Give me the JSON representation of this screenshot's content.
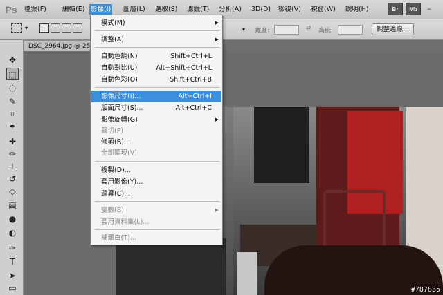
{
  "app": {
    "logo": "Ps"
  },
  "menubar": {
    "items": [
      "檔案(F)",
      "編輯(E)",
      "影像(I)",
      "圖層(L)",
      "選取(S)",
      "濾鏡(T)",
      "分析(A)",
      "3D(D)",
      "檢視(V)",
      "視窗(W)",
      "說明(H)"
    ],
    "active_index": 2,
    "right_icons": [
      "Br",
      "Mb"
    ],
    "window_buttons": [
      "–",
      "□",
      "×"
    ]
  },
  "options": {
    "width_label": "寬度:",
    "height_label": "高度:",
    "refine_edge_button": "調整邊緣..."
  },
  "document": {
    "tab_title": "DSC_2964.jpg @ 25"
  },
  "image_menu": {
    "items": [
      {
        "label": "模式(M)",
        "shortcut": "",
        "submenu": true,
        "disabled": false
      },
      {
        "label": "調整(A)",
        "shortcut": "",
        "submenu": true,
        "disabled": false
      },
      {
        "label": "自動色調(N)",
        "shortcut": "Shift+Ctrl+L",
        "submenu": false,
        "disabled": false
      },
      {
        "label": "自動對比(U)",
        "shortcut": "Alt+Shift+Ctrl+L",
        "submenu": false,
        "disabled": false
      },
      {
        "label": "自動色彩(O)",
        "shortcut": "Shift+Ctrl+B",
        "submenu": false,
        "disabled": false
      },
      {
        "label": "影像尺寸(I)...",
        "shortcut": "Alt+Ctrl+I",
        "submenu": false,
        "disabled": false,
        "highlighted": true
      },
      {
        "label": "版面尺寸(S)...",
        "shortcut": "Alt+Ctrl+C",
        "submenu": false,
        "disabled": false
      },
      {
        "label": "影像旋轉(G)",
        "shortcut": "",
        "submenu": true,
        "disabled": false
      },
      {
        "label": "裁切(P)",
        "shortcut": "",
        "submenu": false,
        "disabled": true
      },
      {
        "label": "修剪(R)...",
        "shortcut": "",
        "submenu": false,
        "disabled": false
      },
      {
        "label": "全部顯現(V)",
        "shortcut": "",
        "submenu": false,
        "disabled": true
      },
      {
        "label": "複製(D)...",
        "shortcut": "",
        "submenu": false,
        "disabled": false
      },
      {
        "label": "套用影像(Y)...",
        "shortcut": "",
        "submenu": false,
        "disabled": false
      },
      {
        "label": "運算(C)...",
        "shortcut": "",
        "submenu": false,
        "disabled": false
      },
      {
        "label": "變數(B)",
        "shortcut": "",
        "submenu": true,
        "disabled": true
      },
      {
        "label": "套用資料集(L)...",
        "shortcut": "",
        "submenu": false,
        "disabled": true
      },
      {
        "label": "補漏白(T)...",
        "shortcut": "",
        "submenu": false,
        "disabled": true
      }
    ]
  },
  "watermark": "#787835",
  "colors": {
    "menu_highlight": "#3b8fdc",
    "toolbar_bg": "#cfcfcf",
    "canvas_bg": "#6b6b6b"
  }
}
